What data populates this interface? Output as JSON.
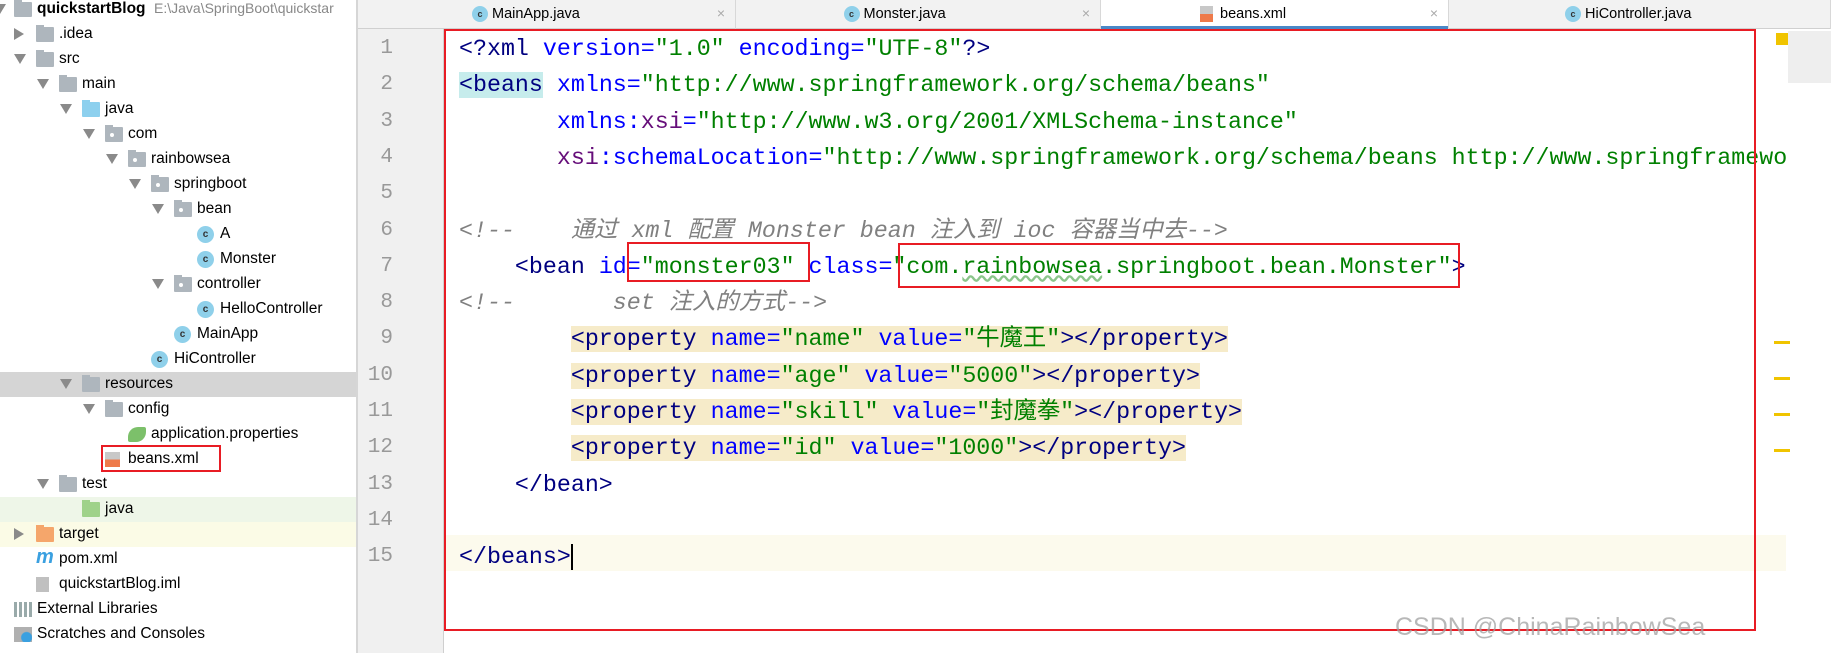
{
  "project_tree": [
    {
      "label": "quickstartBlog",
      "path": "E:\\Java\\SpringBoot\\quickstar",
      "level": 0,
      "state": "expanded",
      "icon": "module-folder-icon",
      "bold": true
    },
    {
      "label": ".idea",
      "level": 1,
      "state": "collapsed",
      "icon": "folder-icon"
    },
    {
      "label": "src",
      "level": 1,
      "state": "expanded",
      "icon": "folder-icon"
    },
    {
      "label": "main",
      "level": 2,
      "state": "expanded",
      "icon": "folder-icon"
    },
    {
      "label": "java",
      "level": 3,
      "state": "expanded",
      "icon": "source-folder-icon"
    },
    {
      "label": "com",
      "level": 4,
      "state": "expanded",
      "icon": "package-icon"
    },
    {
      "label": "rainbowsea",
      "level": 5,
      "state": "expanded",
      "icon": "package-icon"
    },
    {
      "label": "springboot",
      "level": 6,
      "state": "expanded",
      "icon": "package-icon"
    },
    {
      "label": "bean",
      "level": 7,
      "state": "expanded",
      "icon": "package-icon"
    },
    {
      "label": "A",
      "level": 8,
      "icon": "class-icon"
    },
    {
      "label": "Monster",
      "level": 8,
      "icon": "class-icon"
    },
    {
      "label": "controller",
      "level": 7,
      "state": "expanded",
      "icon": "package-icon"
    },
    {
      "label": "HelloController",
      "level": 8,
      "icon": "class-icon"
    },
    {
      "label": "MainApp",
      "level": 7,
      "icon": "spring-boot-class-icon"
    },
    {
      "label": "HiController",
      "level": 6,
      "icon": "class-icon"
    },
    {
      "label": "resources",
      "level": 3,
      "state": "expanded",
      "icon": "resources-folder-icon",
      "selected": true
    },
    {
      "label": "config",
      "level": 4,
      "state": "expanded",
      "icon": "folder-icon"
    },
    {
      "label": "application.properties",
      "level": 5,
      "icon": "spring-properties-icon"
    },
    {
      "label": "beans.xml",
      "level": 4,
      "icon": "spring-xml-icon"
    },
    {
      "label": "test",
      "level": 2,
      "state": "expanded",
      "icon": "folder-icon"
    },
    {
      "label": "java",
      "level": 3,
      "icon": "test-folder-icon",
      "tint": "#eef6e8"
    },
    {
      "label": "target",
      "level": 1,
      "state": "collapsed",
      "icon": "excluded-folder-icon",
      "tint": "#fbfbe6"
    },
    {
      "label": "pom.xml",
      "level": 1,
      "icon": "maven-icon"
    },
    {
      "label": "quickstartBlog.iml",
      "level": 1,
      "icon": "iml-file-icon"
    },
    {
      "label": "External Libraries",
      "level": 0,
      "icon": "libraries-icon"
    },
    {
      "label": "Scratches and Consoles",
      "level": 0,
      "icon": "scratches-icon"
    }
  ],
  "tabs": [
    {
      "label": "MainApp.java",
      "icon": "spring-boot-class-icon"
    },
    {
      "label": "Monster.java",
      "icon": "class-icon"
    },
    {
      "label": "beans.xml",
      "icon": "spring-xml-icon",
      "active": true
    },
    {
      "label": "HiController.java",
      "icon": "class-icon"
    }
  ],
  "code": [
    {
      "n": "1",
      "tokens": [
        [
          "p",
          "<?"
        ],
        [
          "tn",
          "xml "
        ],
        [
          "an",
          "version"
        ],
        [
          "an",
          "="
        ],
        [
          "av",
          "\"1.0\" "
        ],
        [
          "an",
          "encoding"
        ],
        [
          "an",
          "="
        ],
        [
          "av",
          "\"UTF-8\""
        ],
        [
          "p",
          "?>"
        ]
      ]
    },
    {
      "n": "2",
      "tokens": [
        [
          "bh",
          "<beans"
        ],
        [
          "tx",
          " "
        ],
        [
          "an",
          "xmlns"
        ],
        [
          "an",
          "="
        ],
        [
          "av",
          "\"http://www.springframework.org/schema/beans\""
        ]
      ]
    },
    {
      "n": "3",
      "tokens": [
        [
          "tx",
          "       "
        ],
        [
          "an",
          "xmlns:"
        ],
        [
          "ns",
          "xsi"
        ],
        [
          "an",
          "="
        ],
        [
          "av",
          "\"http://www.w3.org/2001/XMLSchema-instance\""
        ]
      ]
    },
    {
      "n": "4",
      "tokens": [
        [
          "tx",
          "       "
        ],
        [
          "ns",
          "xsi"
        ],
        [
          "an",
          ":schemaLocation"
        ],
        [
          "an",
          "="
        ],
        [
          "av",
          "\"http://www.springframework.org/schema/beans http://www.springframewo"
        ]
      ]
    },
    {
      "n": "5",
      "tokens": []
    },
    {
      "n": "6",
      "tokens": [
        [
          "cm",
          "<!--    通过 xml 配置 Monster bean 注入到 ioc 容器当中去-->"
        ]
      ]
    },
    {
      "n": "7",
      "tokens": [
        [
          "tx",
          "    "
        ],
        [
          "tn",
          "<bean "
        ],
        [
          "an",
          "id"
        ],
        [
          "an",
          "="
        ],
        [
          "av",
          "\"monster03\" "
        ],
        [
          "an",
          "class"
        ],
        [
          "an",
          "="
        ],
        [
          "av",
          "\"com."
        ],
        [
          "sq",
          "rainbowsea"
        ],
        [
          "av",
          ".springboot.bean.Monster\""
        ],
        [
          "tn",
          ">"
        ]
      ]
    },
    {
      "n": "8",
      "tokens": [
        [
          "cm",
          "<!--       set 注入的方式-->"
        ]
      ]
    },
    {
      "n": "9",
      "hl": true,
      "tokens": [
        [
          "tn",
          "<property "
        ],
        [
          "an",
          "name"
        ],
        [
          "an",
          "="
        ],
        [
          "av",
          "\"name\" "
        ],
        [
          "an",
          "value"
        ],
        [
          "an",
          "="
        ],
        [
          "av",
          "\"牛魔王\""
        ],
        [
          "tn",
          "></property>"
        ]
      ]
    },
    {
      "n": "10",
      "hl": true,
      "tokens": [
        [
          "tn",
          "<property "
        ],
        [
          "an",
          "name"
        ],
        [
          "an",
          "="
        ],
        [
          "av",
          "\"age\" "
        ],
        [
          "an",
          "value"
        ],
        [
          "an",
          "="
        ],
        [
          "av",
          "\"5000\""
        ],
        [
          "tn",
          "></property>"
        ]
      ]
    },
    {
      "n": "11",
      "hl": true,
      "tokens": [
        [
          "tn",
          "<property "
        ],
        [
          "an",
          "name"
        ],
        [
          "an",
          "="
        ],
        [
          "av",
          "\"skill\" "
        ],
        [
          "an",
          "value"
        ],
        [
          "an",
          "="
        ],
        [
          "av",
          "\"封魔拳\""
        ],
        [
          "tn",
          "></property>"
        ]
      ]
    },
    {
      "n": "12",
      "hl": true,
      "tokens": [
        [
          "tn",
          "<property "
        ],
        [
          "an",
          "name"
        ],
        [
          "an",
          "="
        ],
        [
          "av",
          "\"id\" "
        ],
        [
          "an",
          "value"
        ],
        [
          "an",
          "="
        ],
        [
          "av",
          "\"1000\""
        ],
        [
          "tn",
          "></property>"
        ]
      ]
    },
    {
      "n": "13",
      "tokens": [
        [
          "tx",
          "    "
        ],
        [
          "tn",
          "</bean>"
        ]
      ]
    },
    {
      "n": "14",
      "tokens": []
    },
    {
      "n": "15",
      "current": true,
      "tokens": [
        [
          "tn",
          "</beans>"
        ]
      ]
    }
  ],
  "watermark": "CSDN @ChinaRainbowSea",
  "colors": {
    "highlight_box": "#e81c24",
    "active_tab_underline": "#4a88c7",
    "property_highlight": "#f6ebc9",
    "warning_marker": "#f0c400"
  }
}
